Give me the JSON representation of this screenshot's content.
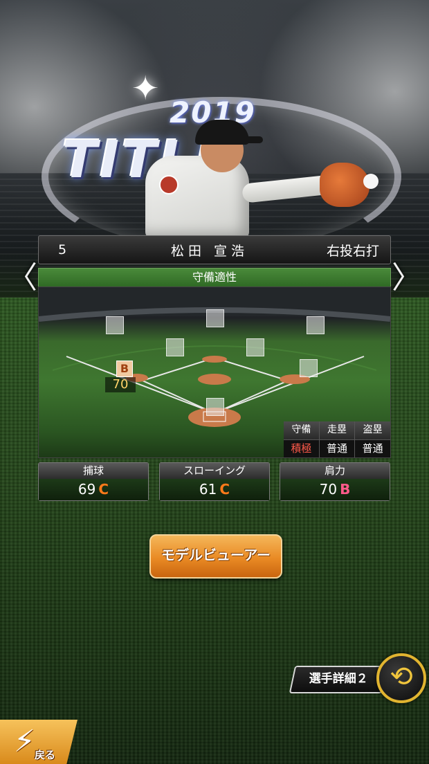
{
  "header": {
    "logo_year": "2019",
    "logo_title": "TITLE"
  },
  "player": {
    "number": "5",
    "name": "松田 宣浩",
    "handedness": "右投右打"
  },
  "nav": {
    "prev_glyph": "〈",
    "next_glyph": "〉"
  },
  "defense": {
    "header": "守備適性",
    "position_rating": "B",
    "position_value": "70",
    "stats": {
      "headers": [
        "守備",
        "走塁",
        "盗塁"
      ],
      "values": [
        "積極",
        "普通",
        "普通"
      ]
    }
  },
  "abilities": [
    {
      "label": "捕球",
      "value": "69",
      "grade": "C",
      "grade_color": "#ff7a1a"
    },
    {
      "label": "スローイング",
      "value": "61",
      "grade": "C",
      "grade_color": "#ff7a1a"
    },
    {
      "label": "肩力",
      "value": "70",
      "grade": "B",
      "grade_color": "#ff5a8a"
    }
  ],
  "buttons": {
    "model_viewer": "モデルビューアー",
    "player_detail": "選手詳細２",
    "back": "戻る"
  },
  "icons": {
    "swap": "swap-arrows-icon",
    "back": "back-bolt-icon"
  },
  "colors": {
    "accent_orange": "#e98a24",
    "panel_green": "#2f6a25",
    "hot_text": "#ff5a4a"
  }
}
